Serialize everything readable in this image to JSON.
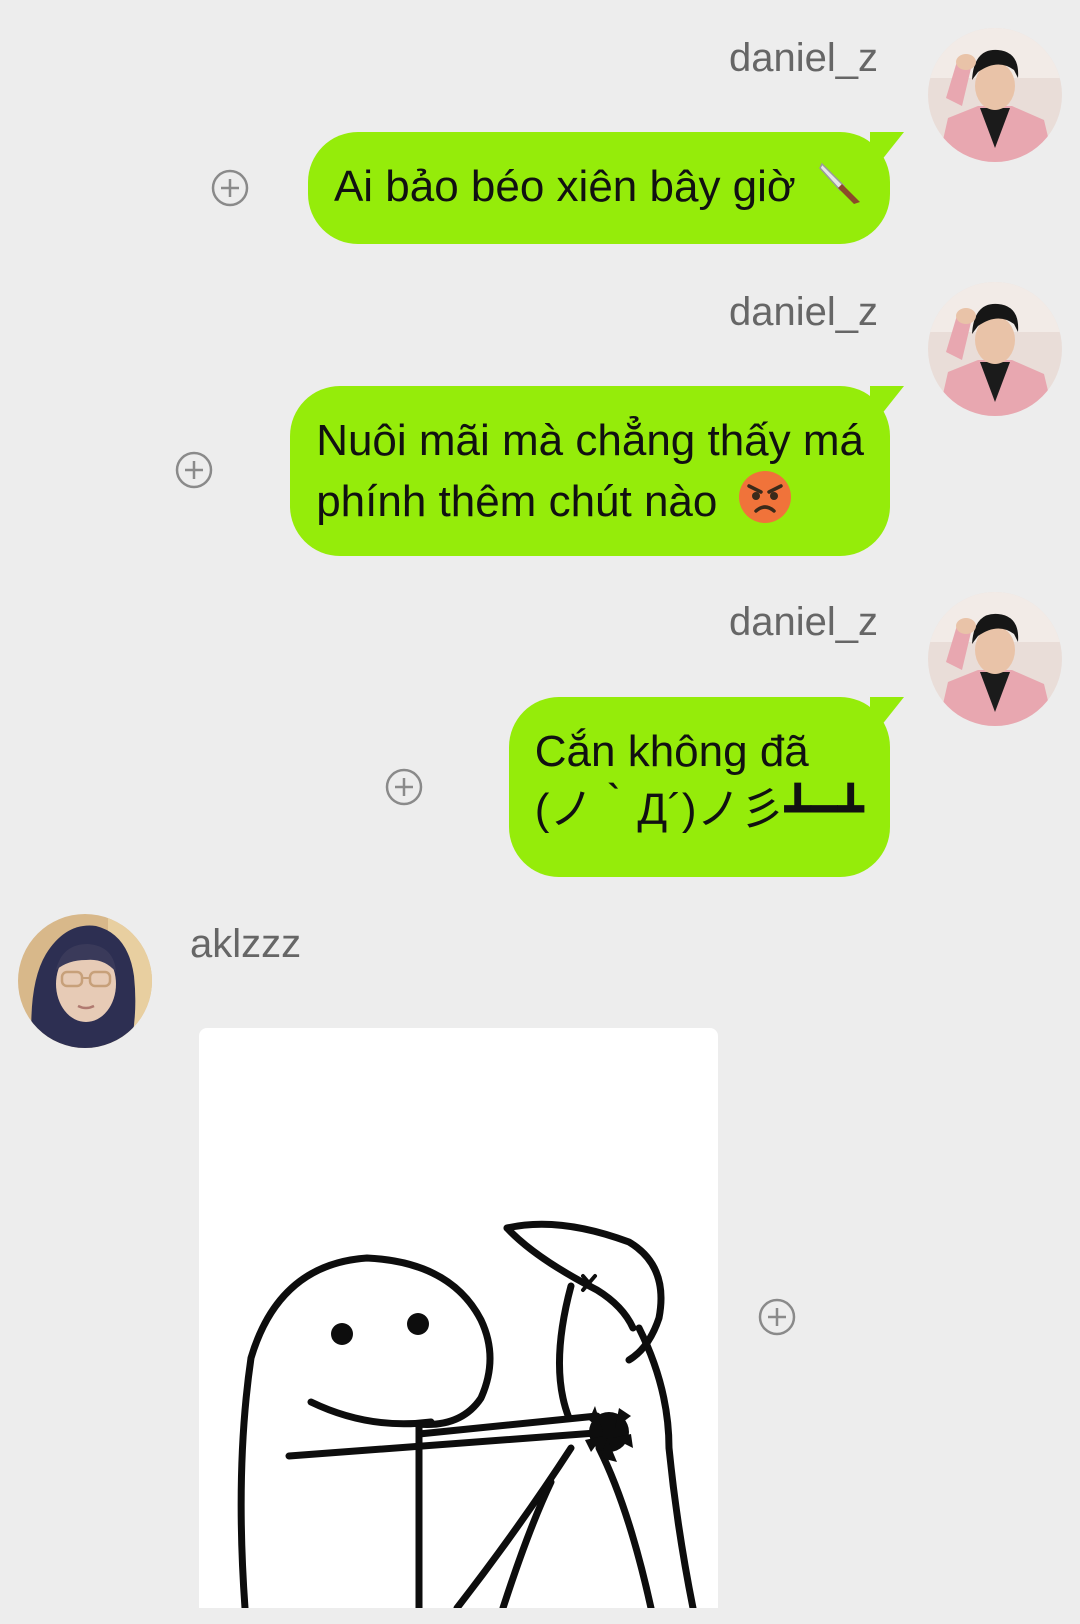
{
  "messages": [
    {
      "sender": "daniel_z",
      "lines": [
        "Ai bảo béo xiên bây giờ"
      ],
      "emoji": "knife-emoji"
    },
    {
      "sender": "daniel_z",
      "lines": [
        "Nuôi mãi mà chẳng thấy má",
        "phính thêm chút nào"
      ],
      "emoji": "angry-face-emoji"
    },
    {
      "sender": "daniel_z",
      "lines": [
        "Cắn không đã",
        "(ノ｀Д´)ノ彡┻━┻"
      ]
    },
    {
      "sender": "aklzzz",
      "type": "sticker",
      "sticker": "stick-figure-stabbing-sticker"
    }
  ],
  "colors": {
    "background": "#ededed",
    "bubble_self": "#95ec0a",
    "username": "#666666",
    "text": "#111111"
  }
}
